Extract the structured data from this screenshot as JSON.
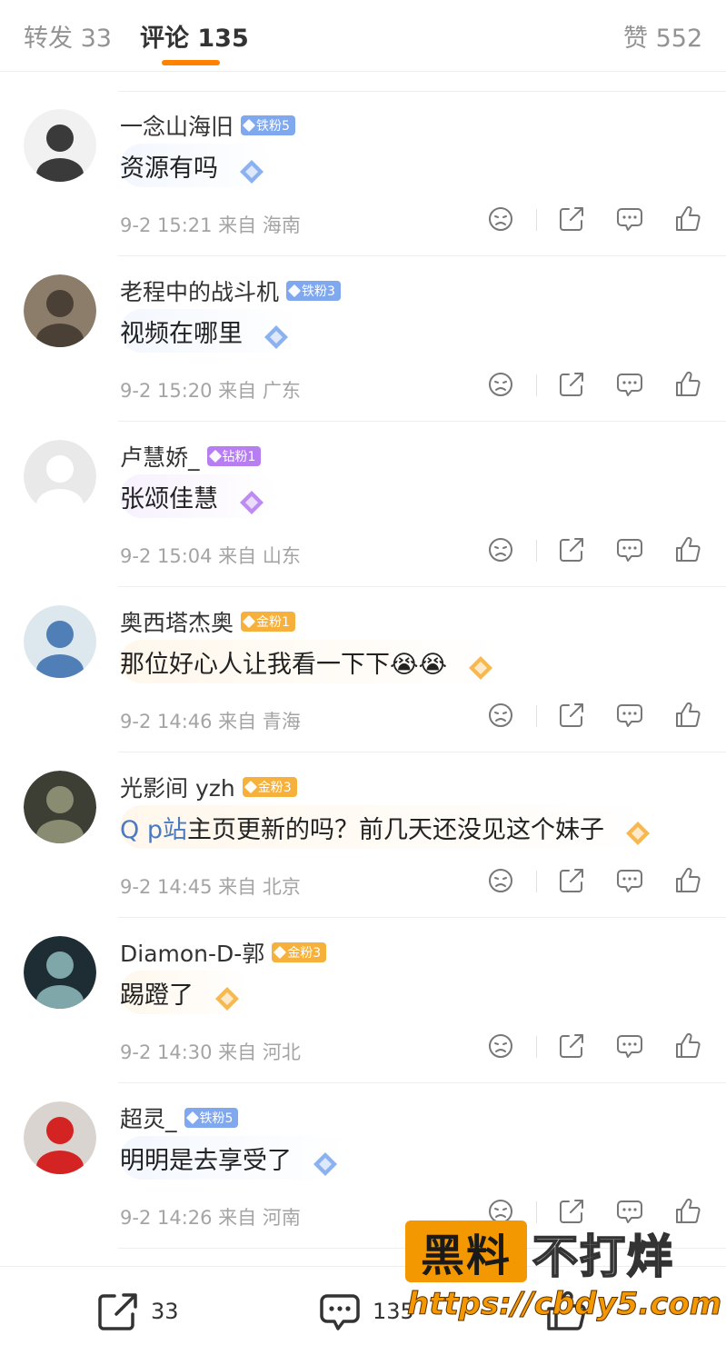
{
  "tabs": {
    "repost": "转发 33",
    "comments": "评论 135",
    "likes": "赞 552"
  },
  "colors": {
    "accent": "#ff8200",
    "tie_badge": "#7fa8ee",
    "zuan_badge": "#b77ef2",
    "jin_badge": "#f6b13c",
    "meta_text": "#a4a4a4"
  },
  "comments": [
    {
      "username": "一念山海旧",
      "badge": "铁粉5",
      "badge_type": "tie",
      "text": "资源有吗",
      "meta": "9-2 15:21 来自 海南",
      "avatar": "sketch-portrait"
    },
    {
      "username": "老程中的战斗机",
      "badge": "铁粉3",
      "badge_type": "tie",
      "text": "视频在哪里",
      "meta": "9-2 15:20 来自 广东",
      "avatar": "koala"
    },
    {
      "username": "卢慧娇_",
      "badge": "钻粉1",
      "badge_type": "zuan",
      "text": "张颂佳慧",
      "meta": "9-2 15:04 来自 山东",
      "avatar": "default-silhouette"
    },
    {
      "username": "奥西塔杰奥",
      "badge": "金粉1",
      "badge_type": "jin",
      "text": "那位好心人让我看一下下",
      "emoji": "😭😭",
      "meta": "9-2 14:46 来自 青海",
      "avatar": "cartoon-character"
    },
    {
      "username": "光影间 yzh",
      "badge": "金粉3",
      "badge_type": "jin",
      "topic": "Q p站",
      "text": "主页更新的吗？前几天还没见这个妹子",
      "meta": "9-2 14:45 来自 北京",
      "avatar": "dark-photo"
    },
    {
      "username": "Diamon-D-郭",
      "badge": "金粉3",
      "badge_type": "jin",
      "text": "踢蹬了",
      "meta": "9-2 14:30 来自 河北",
      "avatar": "joker"
    },
    {
      "username": "超灵_",
      "badge": "铁粉5",
      "badge_type": "tie",
      "text": "明明是去享受了",
      "meta": "9-2 14:26 来自 河南",
      "avatar": "red-monster"
    }
  ],
  "bottom_bar": {
    "repost_count": "33",
    "comment_count": "135"
  },
  "watermark": {
    "box_text": "黑料",
    "right_text": "不打烊",
    "url": "https://cbdy5.com"
  }
}
